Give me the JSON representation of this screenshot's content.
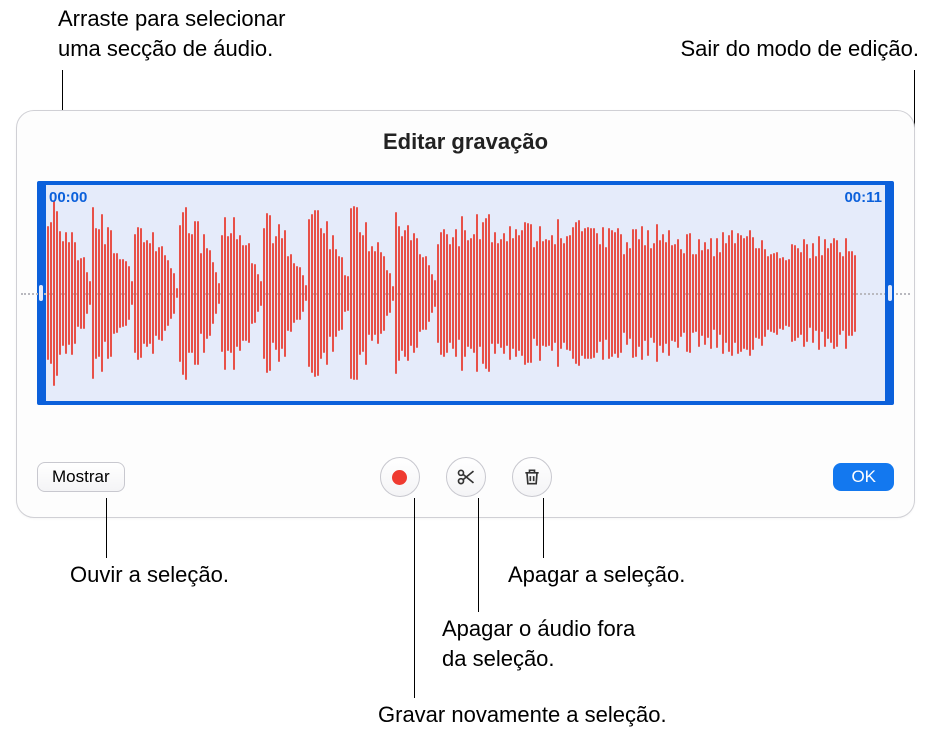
{
  "callouts": {
    "drag_select": "Arraste para selecionar\numa secção de áudio.",
    "exit_edit": "Sair do modo de edição.",
    "listen": "Ouvir a seleção.",
    "delete_sel": "Apagar a seleção.",
    "delete_outside": "Apagar o áudio fora\nda seleção.",
    "rerecord": "Gravar novamente a seleção."
  },
  "panel": {
    "title": "Editar gravação",
    "time_start": "00:00",
    "time_end": "00:11"
  },
  "toolbar": {
    "show_label": "Mostrar",
    "ok_label": "OK",
    "icons": {
      "record": "record-icon",
      "scissors": "scissors-icon",
      "trash": "trash-icon"
    }
  }
}
